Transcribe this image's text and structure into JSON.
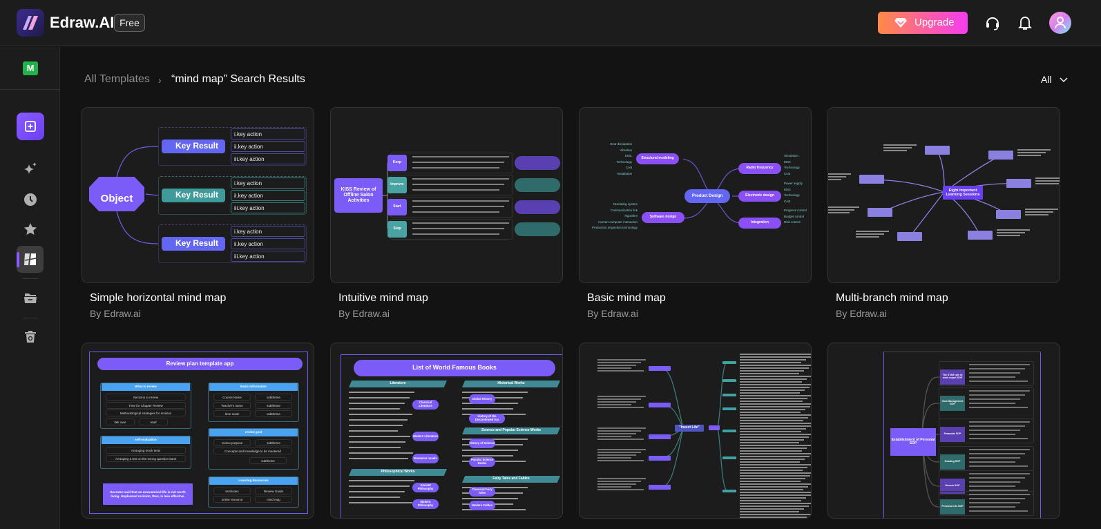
{
  "header": {
    "brand": "Edraw.AI",
    "plan_badge": "Free",
    "upgrade_label": "Upgrade",
    "icons": [
      "support-headset-icon",
      "bell-icon",
      "user-avatar-icon"
    ],
    "accent": "#8a5cff"
  },
  "sidebar": {
    "workspace_initial": "M",
    "workspace_color": "#22b24c",
    "items": [
      "new-file",
      "ai-sparkle",
      "recent",
      "favorites",
      "templates",
      "files",
      "trash"
    ],
    "active": "templates"
  },
  "breadcrumb": {
    "root": "All Templates",
    "separator": ">",
    "current": "“mind map” Search Results"
  },
  "filter": {
    "selected": "All"
  },
  "cards": [
    {
      "title": "Simple horizontal mind map",
      "author": "By Edraw.ai",
      "thumb": {
        "root": "Object",
        "branch": "Key Result",
        "leaves": [
          "i.key action",
          "ii.key action",
          "iii.key action"
        ]
      }
    },
    {
      "title": "Intuitive mind map",
      "author": "By Edraw.ai",
      "thumb": {
        "root": "KISS Review of Offline Salon Activities",
        "branches": [
          "Keep",
          "Improve",
          "Start",
          "Stop"
        ]
      }
    },
    {
      "title": "Basic mind map",
      "author": "By Edraw.ai",
      "thumb": {
        "root": "Product Design",
        "branches": [
          {
            "label": "Structural modeling",
            "leaves": [
              "Heat dissipation",
              "Vibration",
              "EMC",
              "Technology",
              "Cost",
              "Installation"
            ]
          },
          {
            "label": "Software design",
            "leaves": [
              "Operating system",
              "Communication link",
              "Algorithm",
              "Human-computer interaction",
              "Production inspection technology"
            ]
          },
          {
            "label": "Radio frequency",
            "leaves": [
              "Simulation",
              "EMC",
              "Technology",
              "Cost"
            ]
          },
          {
            "label": "Electronic design",
            "leaves": [
              "Power supply",
              "EMC",
              "Technology",
              "Cost"
            ]
          },
          {
            "label": "Integration",
            "leaves": [
              "Progress control",
              "Budget control",
              "Risk control"
            ]
          }
        ]
      }
    },
    {
      "title": "Multi-branch mind map",
      "author": "By Edraw.ai",
      "thumb": {
        "root": "Eight Important Learning Sessions"
      }
    },
    {
      "title": "",
      "author": "",
      "thumb": {
        "root": "Review plan template app",
        "sections": [
          {
            "label": "What to review",
            "items": [
              "Sections to review",
              "Time for Chapter Review",
              "Methodological strategies for revision",
              "talk over",
              "read"
            ]
          },
          {
            "label": "self-evaluation",
            "items": [
              "Arranging mock tests",
              "Arranging a test on the wrong question bank"
            ]
          },
          {
            "label": "Basic Information",
            "items": [
              "Course Name",
              "subtheme",
              "Teacher's name",
              "subtheme",
              "time scale",
              "subtheme"
            ]
          },
          {
            "label": "review goal",
            "items": [
              "review purpose",
              "subtheme",
              "Concepts and knowledge to be mastered",
              "subtheme"
            ]
          },
          {
            "label": "Learning Resources",
            "items": [
              "textbooks",
              "Review Guide",
              "online resource",
              "mind map"
            ]
          }
        ],
        "quote": "Socrates said that an unexamined life is not worth living. Unplanned revision, then, is less effective."
      }
    },
    {
      "title": "",
      "author": "",
      "thumb": {
        "root": "List of World Famous Books",
        "sections": [
          "Literature",
          "Philosophical Works",
          "Historical Works",
          "Science and Popular Science Works",
          "Fairy Tales and Fables"
        ],
        "nodes": [
          "Classical Literature",
          "Modern Literature",
          "Romance novels",
          "Ancient Philosophy",
          "Modern Philosophy",
          "Global History",
          "History of the Discontinued Era",
          "History of Science",
          "Popular Science Books",
          "Classical Fairy Tales",
          "Modern Fables"
        ]
      }
    },
    {
      "title": "",
      "author": "",
      "thumb": {
        "root": "\"Insect Life\""
      }
    },
    {
      "title": "",
      "author": "",
      "thumb": {
        "root": "Establishment of Personal SOP",
        "branches": [
          "The STAR rule of work report SOP",
          "Goal Management SOP",
          "Peramide SOP",
          "Reading SOP",
          "Review SOP",
          "Personal Life SOP"
        ]
      }
    }
  ]
}
